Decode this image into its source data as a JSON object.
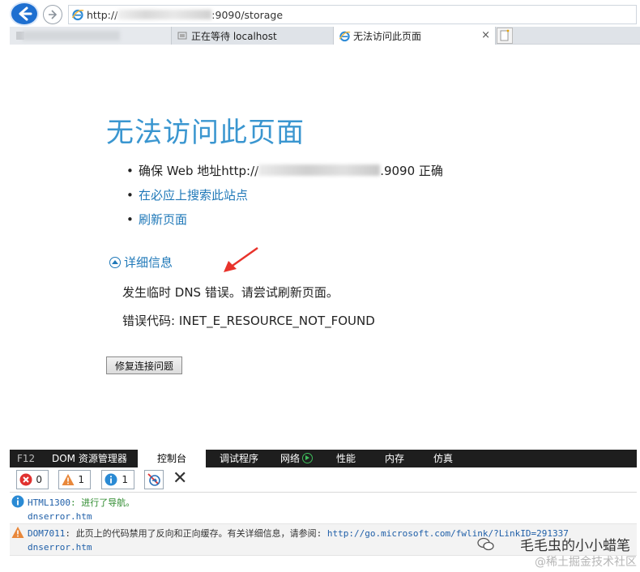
{
  "browser": {
    "url_prefix": "http://",
    "url_suffix": ":9090/storage",
    "tabs": [
      {
        "label": ""
      },
      {
        "label": "正在等待 localhost"
      },
      {
        "label": "无法访问此页面"
      }
    ],
    "tab_close": "×"
  },
  "page": {
    "headline": "无法访问此页面",
    "bullets": {
      "check_prefix": "确保 Web 地址http://",
      "check_suffix": ".9090 正确",
      "search_link": "在必应上搜索此站点",
      "refresh_link": "刷新页面"
    },
    "details_label": "详细信息",
    "detail_message": "发生临时 DNS 错误。请尝试刷新页面。",
    "error_code": "错误代码: INET_E_RESOURCE_NOT_FOUND",
    "fix_button": "修复连接问题"
  },
  "devtools": {
    "tabs": [
      "F12",
      "DOM 资源管理器",
      "控制台",
      "调试程序",
      "网络",
      "性能",
      "内存",
      "仿真"
    ],
    "active_tab": "控制台",
    "error_count": "0",
    "warning_count": "1",
    "info_count": "1",
    "close_glyph": "✕",
    "messages": [
      {
        "level": "info",
        "code": "HTML1300",
        "text": ": 进行了导航。",
        "source": "dnserror.htm"
      },
      {
        "level": "warning",
        "code": "DOM7011",
        "text": ": 此页上的代码禁用了反向和正向缓存。有关详细信息，请参阅: ",
        "link": "http://go.microsoft.com/fwlink/?LinkID=291337",
        "source": "dnserror.htm"
      }
    ]
  },
  "watermark": {
    "line1": "毛毛虫的小小蜡笔",
    "line2": "@稀土掘金技术社区"
  },
  "colors": {
    "headline": "#3a96d0",
    "link": "#1f78b8",
    "devtools_bar": "#1e1e1e",
    "error": "#e0312f",
    "warning": "#e8873a",
    "info": "#2a8ad4"
  }
}
